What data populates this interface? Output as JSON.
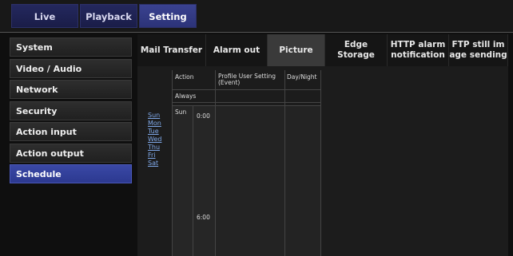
{
  "top_tabs": [
    {
      "label": "Live",
      "active": false
    },
    {
      "label": "Playback",
      "active": false
    },
    {
      "label": "Setting",
      "active": true
    }
  ],
  "sidebar": [
    {
      "label": "System",
      "active": false
    },
    {
      "label": "Video / Audio",
      "active": false
    },
    {
      "label": "Network",
      "active": false
    },
    {
      "label": "Security",
      "active": false
    },
    {
      "label": "Action input",
      "active": false
    },
    {
      "label": "Action output",
      "active": false
    },
    {
      "label": "Schedule",
      "active": true
    }
  ],
  "tabs": [
    {
      "label": "Mail Transfer",
      "active": false
    },
    {
      "label": "Alarm out",
      "active": false
    },
    {
      "label": "Picture",
      "active": true
    },
    {
      "label": "Edge Storage",
      "active": false
    },
    {
      "label1": "HTTP alarm",
      "label2": "notification",
      "active": false
    },
    {
      "label1": "FTP still im",
      "label2": "age sending",
      "active": false
    }
  ],
  "schedule": {
    "header_action": "Action",
    "header_profile": "Profile User Setting (Event)",
    "header_daynight": "Day/Night",
    "always": "Always",
    "day_label": "Sun",
    "times": [
      "0:00",
      "6:00"
    ],
    "day_links": [
      "Sun",
      "Mon",
      "Tue",
      "Wed",
      "Thu",
      "Fri",
      "Sat"
    ]
  },
  "colors": {
    "accent": "#2c3990",
    "background": "#0f0f0f"
  }
}
